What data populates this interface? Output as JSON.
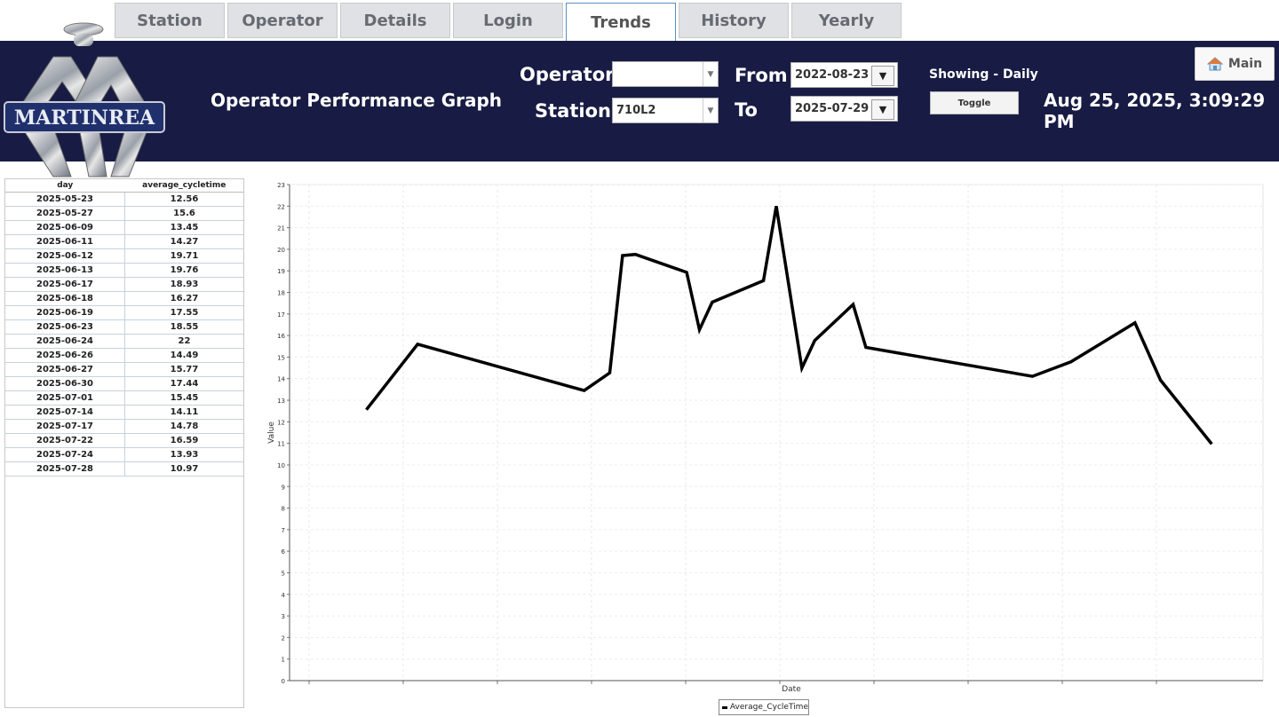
{
  "tabs": [
    "Station",
    "Operator",
    "Details",
    "Login",
    "Trends",
    "History",
    "Yearly"
  ],
  "active_tab": "Trends",
  "logo_text": "MARTINREA",
  "page_title": "Operator Performance Graph",
  "filters": {
    "operator_label": "Operator",
    "operator_value": "",
    "station_label": "Station",
    "station_value": "710L2",
    "from_label": "From",
    "from_value": "2022-08-23",
    "to_label": "To",
    "to_value": "2025-07-29"
  },
  "showing_label": "Showing - Daily",
  "toggle_label": "Toggle",
  "datetime": "Aug 25, 2025, 3:09:29 PM",
  "main_button": "Main",
  "table": {
    "headers": [
      "day",
      "average_cycletime"
    ],
    "rows": [
      [
        "2025-05-23",
        "12.56"
      ],
      [
        "2025-05-27",
        "15.6"
      ],
      [
        "2025-06-09",
        "13.45"
      ],
      [
        "2025-06-11",
        "14.27"
      ],
      [
        "2025-06-12",
        "19.71"
      ],
      [
        "2025-06-13",
        "19.76"
      ],
      [
        "2025-06-17",
        "18.93"
      ],
      [
        "2025-06-18",
        "16.27"
      ],
      [
        "2025-06-19",
        "17.55"
      ],
      [
        "2025-06-23",
        "18.55"
      ],
      [
        "2025-06-24",
        "22"
      ],
      [
        "2025-06-26",
        "14.49"
      ],
      [
        "2025-06-27",
        "15.77"
      ],
      [
        "2025-06-30",
        "17.44"
      ],
      [
        "2025-07-01",
        "15.45"
      ],
      [
        "2025-07-14",
        "14.11"
      ],
      [
        "2025-07-17",
        "14.78"
      ],
      [
        "2025-07-22",
        "16.59"
      ],
      [
        "2025-07-24",
        "13.93"
      ],
      [
        "2025-07-28",
        "10.97"
      ]
    ]
  },
  "chart_data": {
    "type": "line",
    "xlabel": "Date",
    "ylabel": "Value",
    "ylim": [
      0,
      23
    ],
    "yticks": [
      0,
      1,
      2,
      3,
      4,
      5,
      6,
      7,
      8,
      9,
      10,
      11,
      12,
      13,
      14,
      15,
      16,
      17,
      18,
      19,
      20,
      21,
      22,
      23
    ],
    "xlim": [
      "2025-05-17",
      "2025-08-01"
    ],
    "grid": true,
    "legend_position": "bottom-center",
    "series": [
      {
        "name": "Average_CycleTime",
        "color": "#000000",
        "x": [
          "2025-05-23",
          "2025-05-27",
          "2025-06-09",
          "2025-06-11",
          "2025-06-12",
          "2025-06-13",
          "2025-06-17",
          "2025-06-18",
          "2025-06-19",
          "2025-06-23",
          "2025-06-24",
          "2025-06-26",
          "2025-06-27",
          "2025-06-30",
          "2025-07-01",
          "2025-07-14",
          "2025-07-17",
          "2025-07-22",
          "2025-07-24",
          "2025-07-28"
        ],
        "values": [
          12.56,
          15.6,
          13.45,
          14.27,
          19.71,
          19.76,
          18.93,
          16.27,
          17.55,
          18.55,
          22,
          14.49,
          15.77,
          17.44,
          15.45,
          14.11,
          14.78,
          16.59,
          13.93,
          10.97
        ]
      }
    ]
  }
}
